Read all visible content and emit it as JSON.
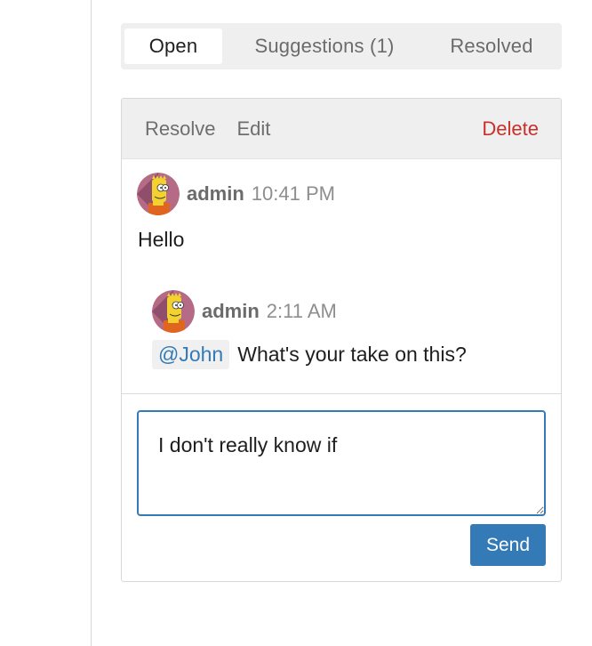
{
  "tabs": [
    {
      "label": "Open",
      "active": true
    },
    {
      "label": "Suggestions (1)",
      "active": false
    },
    {
      "label": "Resolved",
      "active": false
    }
  ],
  "toolbar": {
    "resolve_label": "Resolve",
    "edit_label": "Edit",
    "delete_label": "Delete"
  },
  "comments": [
    {
      "author": "admin",
      "time": "10:41 PM",
      "text": "Hello",
      "avatar_icon": "cartoon-avatar-icon"
    },
    {
      "author": "admin",
      "time": "2:11 AM",
      "mention": "@John",
      "text": "What's your take on this?",
      "avatar_icon": "cartoon-avatar-icon"
    }
  ],
  "reply": {
    "value": "I don't really know if",
    "send_label": "Send"
  },
  "colors": {
    "accent": "#337ab7",
    "danger": "#c9302c",
    "toolbar_bg": "#efefef"
  }
}
